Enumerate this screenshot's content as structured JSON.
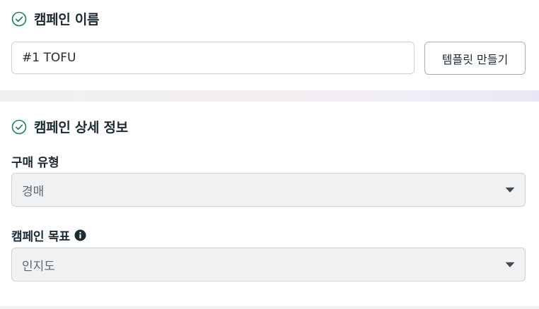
{
  "campaign_name_section": {
    "title": "캠페인 이름",
    "name_input_value": "#1 TOFU",
    "template_button_label": "템플릿 만들기"
  },
  "campaign_details_section": {
    "title": "캠페인 상세 정보",
    "buying_type": {
      "label": "구매 유형",
      "selected": "경매"
    },
    "campaign_objective": {
      "label": "캠페인 목표",
      "selected": "인지도"
    }
  },
  "icons": {
    "section_status": "check-circle-icon",
    "objective_info": "info-icon",
    "select_caret": "caret-down-icon"
  },
  "colors": {
    "check_green": "#1e7f57",
    "text_primary": "#1c2b33",
    "select_background": "#f1f2f4"
  }
}
